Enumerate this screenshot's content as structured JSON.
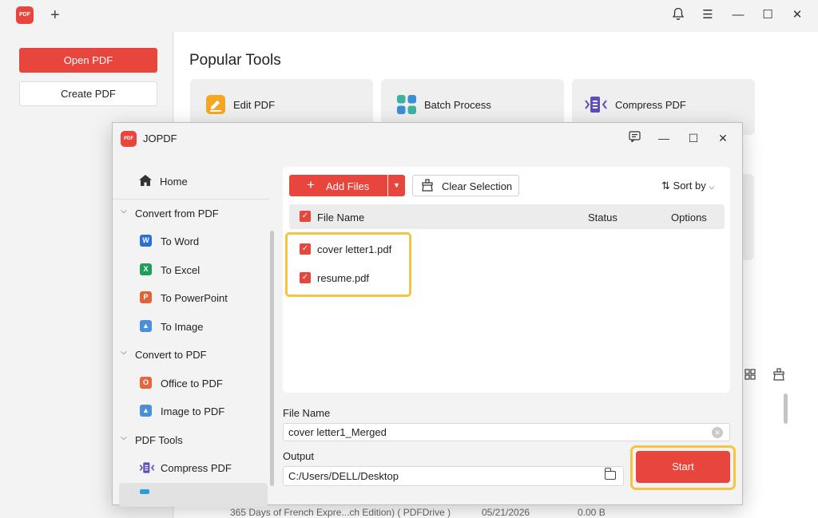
{
  "app": {
    "logo_text": "PDF",
    "new_tab_label": "+",
    "controls": {
      "bell": "🔔",
      "menu": "☰",
      "minimize": "—",
      "maximize": "☐",
      "close": "✕"
    }
  },
  "left_panel": {
    "open_label": "Open PDF",
    "create_label": "Create PDF"
  },
  "main": {
    "popular_title": "Popular Tools",
    "tools": [
      {
        "label": "Edit PDF",
        "icon": "edit-icon",
        "color": "#f5a623"
      },
      {
        "label": "Batch Process",
        "icon": "batch-icon",
        "color": "#3bb3a0"
      },
      {
        "label": "Compress PDF",
        "icon": "compress-icon",
        "color": "#5b4fb8"
      }
    ],
    "file_row_preview": {
      "name": "365 Days of French Expre...ch Edition) ( PDFDrive )",
      "date": "05/21/2026",
      "size": "0.00 B"
    }
  },
  "dialog": {
    "title": "JOPDF",
    "logo_text": "PDF",
    "controls": {
      "feedback": "▤",
      "minimize": "—",
      "maximize": "☐",
      "close": "✕"
    },
    "sidebar": {
      "home": "Home",
      "convert_from": "Convert from PDF",
      "to_word": "To Word",
      "to_excel": "To Excel",
      "to_powerpoint": "To PowerPoint",
      "to_image": "To Image",
      "convert_to": "Convert to PDF",
      "office_to_pdf": "Office to PDF",
      "image_to_pdf": "Image to PDF",
      "pdf_tools": "PDF Tools",
      "compress_pdf": "Compress PDF"
    },
    "toolbar": {
      "add_files": "Add Files",
      "clear_selection": "Clear Selection",
      "sort_by": "Sort by"
    },
    "table": {
      "col_name": "File Name",
      "col_status": "Status",
      "col_options": "Options",
      "rows": [
        {
          "name": "cover letter1.pdf",
          "checked": true
        },
        {
          "name": "resume.pdf",
          "checked": true
        }
      ]
    },
    "filename_label": "File Name",
    "filename_value": "cover letter1_Merged",
    "output_label": "Output",
    "output_value": "C:/Users/DELL/Desktop",
    "start_label": "Start"
  },
  "colors": {
    "accent": "#e8453c",
    "highlight": "#f6c443"
  }
}
